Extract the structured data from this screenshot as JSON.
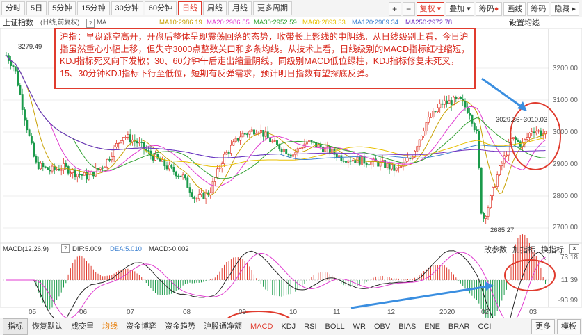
{
  "toolbar": {
    "periods": [
      "分时",
      "5日",
      "5分钟",
      "15分钟",
      "30分钟",
      "60分钟",
      "日线",
      "周线",
      "月线",
      "更多周期"
    ],
    "active_period": "日线",
    "right_items": [
      "复权",
      "叠加",
      "筹码",
      "画线",
      "筹码",
      "隐藏"
    ],
    "plus": "+",
    "minus": "−",
    "more_left": "⋮"
  },
  "index_name": "上证指数",
  "adj_label": "(日线,前复权)",
  "ma_label": "MA",
  "ma_values": [
    {
      "label": "MA10:2986.19",
      "color": "#c8a000"
    },
    {
      "label": "MA20:2986.55",
      "color": "#e03bd0"
    },
    {
      "label": "MA30:2952.59",
      "color": "#30a030"
    },
    {
      "label": "MA60:2893.33",
      "color": "#e8c000"
    },
    {
      "label": "MA120:2969.34",
      "color": "#3a7fd0"
    },
    {
      "label": "MA250:2972.78",
      "color": "#7030c0"
    }
  ],
  "settings_ma": "设置均线",
  "annotation": "沪指：早盘跳空高开，开盘后整体呈现震荡回落的态势，收带长上影线的中阴线。从日线级别上看，今日沪指虽然重心小幅上移，但失守3000点整数关口和多条均线。从技术上看，日线级别的MACD指标红柱缩短，KDJ指标死叉向下发散；30、60分钟午后走出缩量阴线，同级别MACD低位绿柱，KDJ指标修复未死叉，15、30分钟KDJ指标下行至低位，短期有反弹需求，预计明日指数有望探底反弹。",
  "price_labels": {
    "high": "3279.49",
    "low": "2685.27",
    "range": "3029.36~3010.03"
  },
  "y_axis": [
    "3200.00",
    "3100.00",
    "3000.00",
    "2900.00",
    "2800.00",
    "2700.00"
  ],
  "macd_header": {
    "name": "MACD(12,26,9)",
    "dif": "DIF:5.009",
    "dea": "DEA:5.010",
    "macd": "MACD:-0.002"
  },
  "macd_tools": [
    "改参数",
    "加指标",
    "换指标"
  ],
  "macd_y": [
    "73.18",
    "11.39",
    "-93.99"
  ],
  "x_axis": [
    "05",
    "06",
    "07",
    "08",
    "09",
    "10",
    "11",
    "12",
    "2020",
    "02",
    "03"
  ],
  "bottom_tabs": [
    "指标",
    "恢复默认",
    "成交里",
    "均线",
    "资金博弈",
    "资金趋势",
    "沪股通净额",
    "MACD",
    "KDJ",
    "RSI",
    "BOLL",
    "WR",
    "OBV",
    "BIAS",
    "ENE",
    "BRAR",
    "CCI"
  ],
  "bottom_right": [
    "更多",
    "模板"
  ],
  "colors": {
    "up": "#e03b2e",
    "down": "#1a9a4a",
    "accent": "#e03b2e"
  }
}
